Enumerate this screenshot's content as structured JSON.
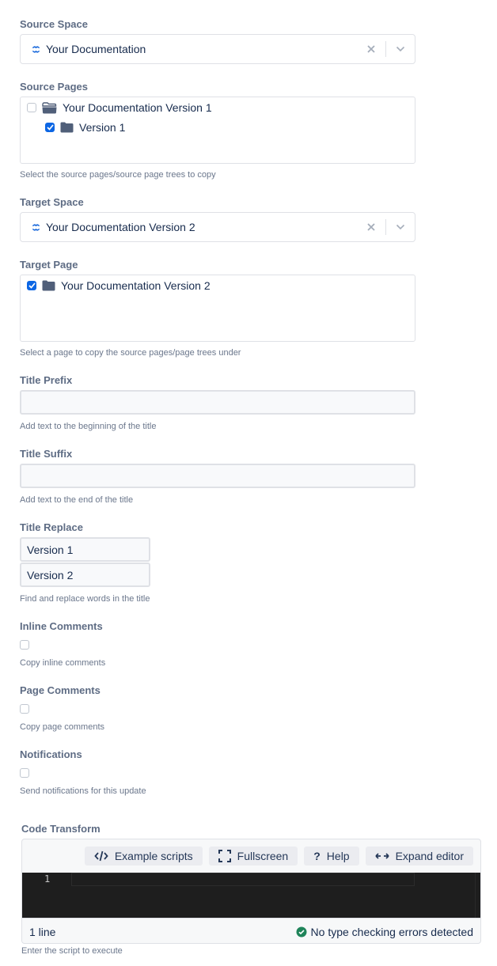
{
  "source_space": {
    "label": "Source Space",
    "value": "Your Documentation",
    "icon": "confluence-space-icon",
    "icon_color": "#1868db"
  },
  "source_pages": {
    "label": "Source Pages",
    "items": [
      {
        "text": "Your Documentation Version 1",
        "checked": false,
        "icon": "folder-open-icon",
        "level": 0
      },
      {
        "text": "Version 1",
        "checked": true,
        "icon": "folder-icon",
        "level": 1
      }
    ],
    "help": "Select the source pages/source page trees to copy"
  },
  "target_space": {
    "label": "Target Space",
    "value": "Your Documentation Version 2",
    "icon": "confluence-space-icon"
  },
  "target_page": {
    "label": "Target Page",
    "items": [
      {
        "text": "Your Documentation Version 2",
        "checked": true,
        "icon": "folder-icon",
        "level": 0
      }
    ],
    "help": "Select a page to copy the source pages/page trees under"
  },
  "title_prefix": {
    "label": "Title Prefix",
    "value": "",
    "help": "Add text to the beginning of the title"
  },
  "title_suffix": {
    "label": "Title Suffix",
    "value": "",
    "help": "Add text to the end of the title"
  },
  "title_replace": {
    "label": "Title Replace",
    "find": "Version 1",
    "replace": "Version 2",
    "help": "Find and replace words in the title"
  },
  "inline_comments": {
    "label": "Inline Comments",
    "checked": false,
    "help": "Copy inline comments"
  },
  "page_comments": {
    "label": "Page Comments",
    "checked": false,
    "help": "Copy page comments"
  },
  "notifications": {
    "label": "Notifications",
    "checked": false,
    "help": "Send notifications for this update"
  },
  "code_transform": {
    "label": "Code Transform",
    "toolbar": {
      "example_scripts": "Example scripts",
      "fullscreen": "Fullscreen",
      "help": "Help",
      "expand_editor": "Expand editor"
    },
    "line_numbers": [
      "1"
    ],
    "line_count": "1 line",
    "type_status": "No type checking errors detected",
    "status_color": "#1f845a",
    "help": "Enter the script to execute"
  },
  "colors": {
    "checkbox_checked": "#0c66e4",
    "folder": "#505f79",
    "editor_bg": "#1e1e1e"
  }
}
